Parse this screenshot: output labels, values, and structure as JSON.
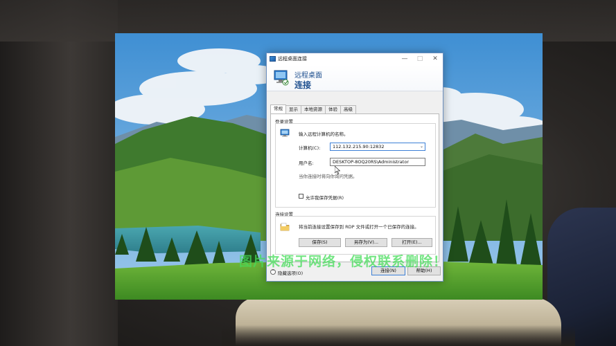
{
  "window": {
    "title": "远程桌面连接",
    "header_line1": "远程桌面",
    "header_line2": "连接",
    "controls": {
      "minimize": "—",
      "maximize": "□",
      "close": "✕"
    }
  },
  "tabs": [
    {
      "label": "常规",
      "active": true
    },
    {
      "label": "显示",
      "active": false
    },
    {
      "label": "本地资源",
      "active": false
    },
    {
      "label": "体验",
      "active": false
    },
    {
      "label": "高级",
      "active": false
    }
  ],
  "logon_settings": {
    "group_label": "登录设置",
    "instruction": "输入远程计算机的名称。",
    "computer_label": "计算机(C):",
    "computer_value": "112.132.215.90:12832",
    "username_label": "用户名:",
    "username_value": "DESKTOP-8OQ20RS\\Administrator",
    "credential_note": "当你连接时将向你询问凭据。",
    "save_credentials_label": "允许我保存凭据(R)",
    "save_credentials_checked": false
  },
  "connection_settings": {
    "group_label": "连接设置",
    "description": "将当前连接设置保存到 RDP 文件或打开一个已保存的连接。",
    "save_button": "保存(S)",
    "save_as_button": "另存为(V)...",
    "open_button": "打开(E)..."
  },
  "footer": {
    "hide_options": "隐藏选项(O)",
    "connect_button": "连接(N)",
    "help_button": "帮助(H)"
  },
  "watermark": "图片来源于网络，侵权联系删除！",
  "icons": {
    "title": "remote-desktop-icon",
    "header": "remote-desktop-icon",
    "logon": "computer-icon",
    "connection": "folder-icon",
    "options": "chevron-up-icon"
  },
  "colors": {
    "accent": "#1e4f8f",
    "focus_border": "#3c7fd6",
    "watermark": "#46dc5a"
  }
}
